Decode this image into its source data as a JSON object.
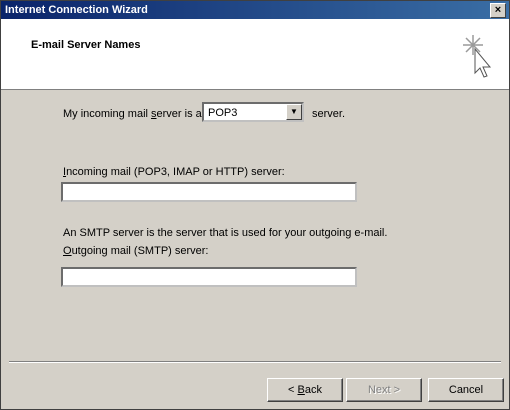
{
  "window": {
    "title": "Internet Connection Wizard",
    "close_glyph": "×"
  },
  "header": {
    "title": "E-mail Server Names",
    "icon": "wizard-cursor-sparkle-icon"
  },
  "form": {
    "server_type_prefix": "My incoming mail server is a",
    "server_type_value": "POP3",
    "server_type_suffix": "server.",
    "incoming_label": "Incoming mail (POP3, IMAP or HTTP) server:",
    "incoming_value": "",
    "smtp_description": "An SMTP server is the server that is used for your outgoing e-mail.",
    "outgoing_label": "Outgoing mail (SMTP) server:",
    "outgoing_value": ""
  },
  "buttons": {
    "back": "< Back",
    "next": "Next >",
    "cancel": "Cancel"
  }
}
